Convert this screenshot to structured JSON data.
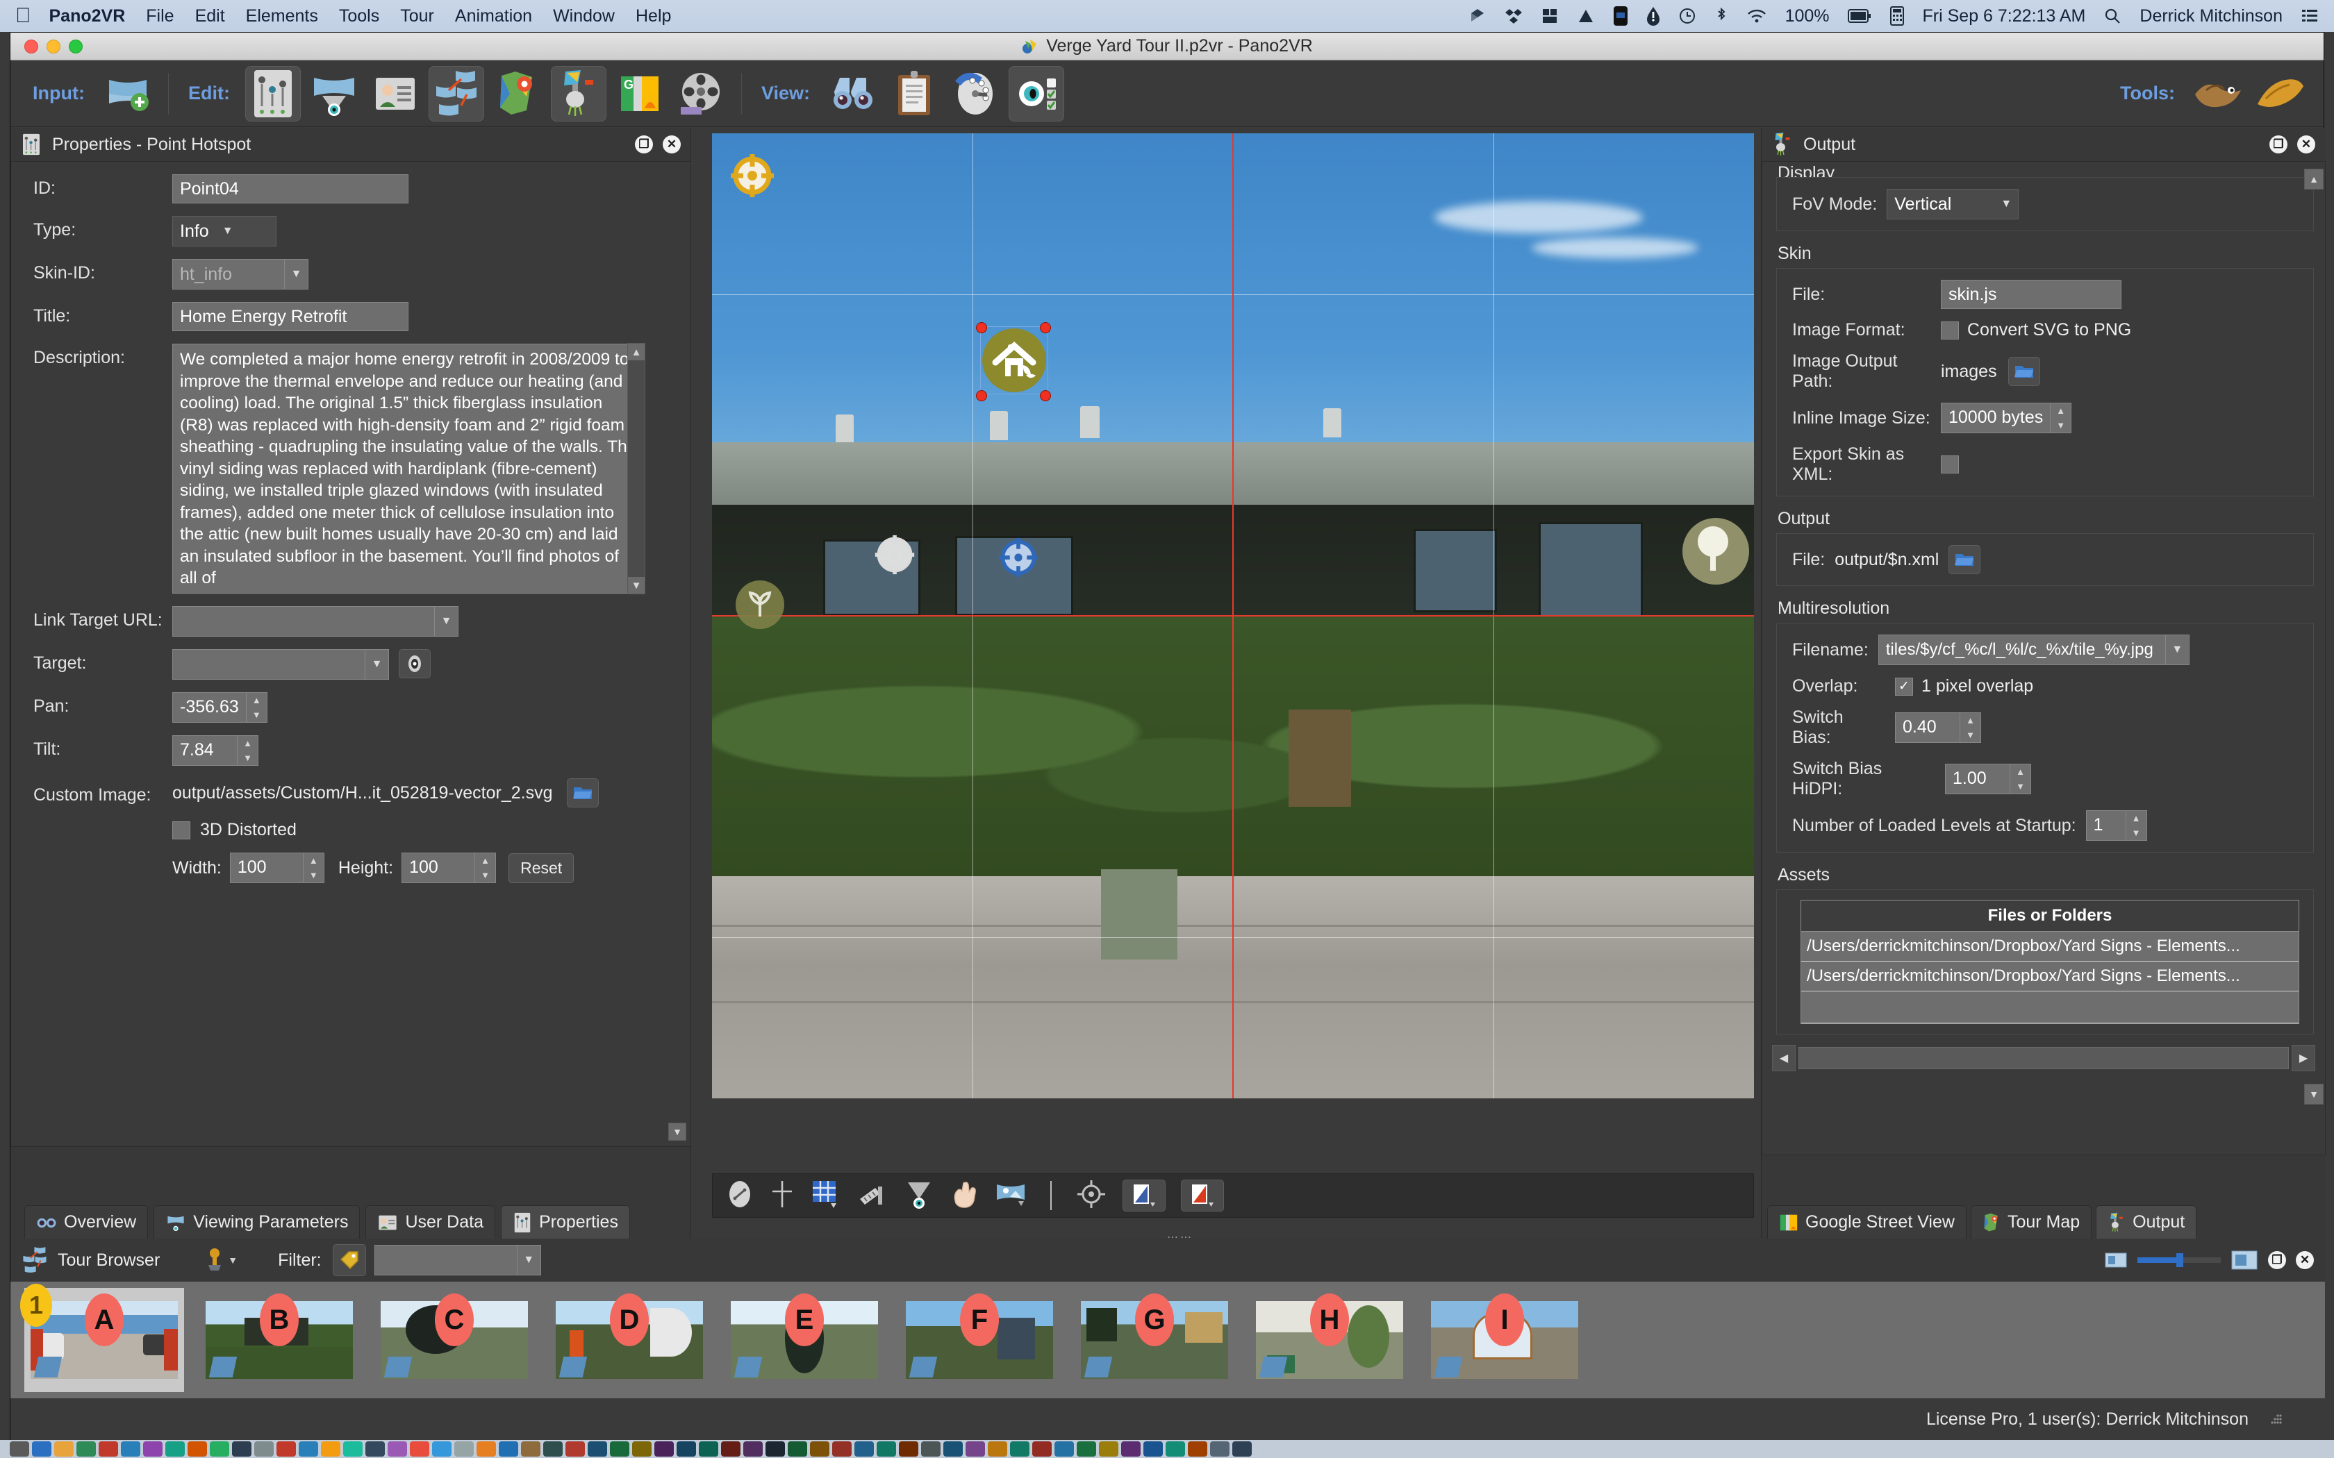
{
  "macbar": {
    "apple_icon": "apple-logo",
    "app_name": "Pano2VR",
    "menus": [
      "File",
      "Edit",
      "Elements",
      "Tools",
      "Tour",
      "Animation",
      "Window",
      "Help"
    ],
    "battery": "100%",
    "clock": "Fri Sep 6  7:22:13 AM",
    "user": "Derrick Mitchinson",
    "status_icons": [
      "dropbox-icon",
      "crashplan-icon",
      "grid-icon",
      "triangle-icon",
      "gopro-icon",
      "drop-icon",
      "timemachine-icon",
      "bluetooth-icon",
      "wifi-icon",
      "battery-icon",
      "calculator-icon",
      "search-icon",
      "menu-list-icon"
    ]
  },
  "window": {
    "title": "Verge Yard Tour II.p2vr - Pano2VR"
  },
  "toolbar": {
    "input_label": "Input:",
    "edit_label": "Edit:",
    "view_label": "View:",
    "tools_label": "Tools:",
    "input_buttons": [
      {
        "name": "add-panorama-icon"
      }
    ],
    "edit_buttons": [
      {
        "name": "properties-panel-icon",
        "selected": true
      },
      {
        "name": "viewing-parameters-icon",
        "selected": false
      },
      {
        "name": "user-data-icon",
        "selected": false
      },
      {
        "name": "tour-browser-icon",
        "selected": true
      },
      {
        "name": "tour-map-icon",
        "selected": false
      },
      {
        "name": "output-icon",
        "selected": true
      },
      {
        "name": "google-street-view-icon",
        "selected": false
      },
      {
        "name": "animation-icon",
        "selected": false
      }
    ],
    "view_buttons": [
      {
        "name": "overview-binoculars-icon",
        "selected": false
      },
      {
        "name": "clipboard-icon",
        "selected": false
      },
      {
        "name": "compass-icon",
        "selected": false
      },
      {
        "name": "visibility-eye-icon",
        "selected": true
      }
    ],
    "tools_buttons": [
      {
        "name": "patch-tool-icon"
      },
      {
        "name": "hand-tool-icon"
      }
    ]
  },
  "properties": {
    "panel_title": "Properties - Point Hotspot",
    "panel_icon": "properties-sliders-icon",
    "fields": {
      "id_label": "ID:",
      "id_value": "Point04",
      "type_label": "Type:",
      "type_value": "Info",
      "skin_id_label": "Skin-ID:",
      "skin_id_value": "ht_info",
      "title_label": "Title:",
      "title_value": "Home Energy Retrofit",
      "description_label": "Description:",
      "description_value": "We completed a major home energy retrofit in 2008/2009 to improve the thermal envelope and reduce our heating (and cooling) load. The original 1.5” thick fiberglass insulation (R8) was replaced with high-density foam and 2” rigid foam sheathing - quadrupling the insulating value of the walls. The vinyl siding was replaced with hardiplank (fibre-cement) siding, we installed triple glazed windows (with insulated frames), added one meter thick of cellulose insulation into the attic (new built homes usually have 20-30 cm) and laid an insulated subfloor in the basement. You’ll find photos of all of",
      "link_target_url_label": "Link Target URL:",
      "link_target_url_value": "",
      "target_label": "Target:",
      "target_value": "",
      "pan_label": "Pan:",
      "pan_value": "-356.63",
      "tilt_label": "Tilt:",
      "tilt_value": "7.84",
      "custom_image_label": "Custom Image:",
      "custom_image_value": "output/assets/Custom/H...it_052819-vector_2.svg",
      "distorted_label": "3D Distorted",
      "distorted_checked": false,
      "width_label": "Width:",
      "width_value": "100",
      "height_label": "Height:",
      "height_value": "100",
      "reset_label": "Reset"
    },
    "tabs": [
      {
        "label": "Overview",
        "icon": "binoculars-icon",
        "active": false
      },
      {
        "label": "Viewing Parameters",
        "icon": "viewing-parameters-icon",
        "active": false
      },
      {
        "label": "User Data",
        "icon": "user-data-icon",
        "active": false
      },
      {
        "label": "Properties",
        "icon": "properties-sliders-icon",
        "active": true
      }
    ]
  },
  "canvas": {
    "hotspots": [
      {
        "name": "hotspot-target-topleft",
        "kind": "target",
        "color": "#e8ab20"
      },
      {
        "name": "hotspot-home-energy",
        "kind": "image",
        "color": "#8c8a2c",
        "selected": true
      },
      {
        "name": "hotspot-target-center",
        "kind": "target",
        "color": "#e8e8e8"
      },
      {
        "name": "hotspot-plant-left",
        "kind": "image",
        "color": "#8b8a4e"
      },
      {
        "name": "hotspot-target-blue",
        "kind": "target",
        "color": "#3c78c8"
      },
      {
        "name": "hotspot-tree-right",
        "kind": "image",
        "color": "#9a9a72"
      }
    ],
    "toolbar_buttons": [
      {
        "name": "compass-icon"
      },
      {
        "name": "crosshair-icon"
      },
      {
        "name": "grid-icon"
      },
      {
        "name": "ruler-icon"
      },
      {
        "name": "visibility-cone-icon"
      },
      {
        "name": "hand-pan-icon"
      },
      {
        "name": "panorama-icon"
      },
      {
        "name": "center-target-icon"
      },
      {
        "name": "fill-color-swatch"
      },
      {
        "name": "stroke-color-swatch"
      }
    ],
    "fill_color": "#3a5ea8",
    "stroke_color": "#d83a1e"
  },
  "output": {
    "panel_title": "Output",
    "panel_icon": "output-icon",
    "groups": {
      "display_label": "Display",
      "fov_mode_label": "FoV Mode:",
      "fov_mode_value": "Vertical",
      "skin_label": "Skin",
      "skin_file_label": "File:",
      "skin_file_value": "skin.js",
      "image_format_label": "Image Format:",
      "convert_svg_label": "Convert SVG to PNG",
      "convert_svg_checked": false,
      "image_output_path_label": "Image Output Path:",
      "image_output_path_value": "images",
      "inline_image_size_label": "Inline Image Size:",
      "inline_image_size_value": "10000 bytes",
      "export_skin_xml_label": "Export Skin as XML:",
      "export_skin_xml_checked": false,
      "output_label": "Output",
      "output_file_label": "File:",
      "output_file_value": "output/$n.xml",
      "multires_label": "Multiresolution",
      "filename_label": "Filename:",
      "filename_value": "tiles/$y/cf_%c/l_%l/c_%x/tile_%y.jpg",
      "overlap_label": "Overlap:",
      "overlap_option": "1 pixel overlap",
      "overlap_checked": true,
      "switch_bias_label": "Switch Bias:",
      "switch_bias_value": "0.40",
      "switch_bias_hidpi_label": "Switch Bias HiDPI:",
      "switch_bias_hidpi_value": "1.00",
      "loaded_levels_label": "Number of Loaded Levels at Startup:",
      "loaded_levels_value": "1",
      "assets_label": "Assets",
      "assets_col_header": "Files or Folders",
      "assets_rows": [
        "/Users/derrickmitchinson/Dropbox/Yard Signs - Elements...",
        "/Users/derrickmitchinson/Dropbox/Yard Signs - Elements..."
      ]
    },
    "tabs": [
      {
        "label": "Google Street View",
        "icon": "google-street-view-icon",
        "active": false
      },
      {
        "label": "Tour Map",
        "icon": "tour-map-icon",
        "active": false
      },
      {
        "label": "Output",
        "icon": "output-icon",
        "active": true
      }
    ]
  },
  "tour_browser": {
    "title": "Tour Browser",
    "icon": "tour-browser-icon",
    "pin_icon": "pin-dropdown-icon",
    "filter_label": "Filter:",
    "filter_icon": "tag-icon",
    "filter_value": "",
    "zoom_small_icon": "thumb-small-icon",
    "zoom_large_icon": "thumb-large-icon",
    "nodes": [
      {
        "letter": "A",
        "number": "1",
        "selected": true
      },
      {
        "letter": "B",
        "number": "",
        "selected": false
      },
      {
        "letter": "C",
        "number": "",
        "selected": false
      },
      {
        "letter": "D",
        "number": "",
        "selected": false
      },
      {
        "letter": "E",
        "number": "",
        "selected": false
      },
      {
        "letter": "F",
        "number": "",
        "selected": false
      },
      {
        "letter": "G",
        "number": "",
        "selected": false
      },
      {
        "letter": "H",
        "number": "",
        "selected": false
      },
      {
        "letter": "I",
        "number": "",
        "selected": false
      }
    ]
  },
  "status": {
    "license_text": "License Pro, 1 user(s): Derrick Mitchinson"
  },
  "dock": {
    "colors": [
      "#5a5a5a",
      "#2b6fc0",
      "#e8a33d",
      "#2e8b57",
      "#c0392b",
      "#2980b9",
      "#8e44ad",
      "#16a085",
      "#d35400",
      "#27ae60",
      "#2c3e50",
      "#7f8c8d",
      "#c0392b",
      "#2980b9",
      "#f39c12",
      "#1abc9c",
      "#34495e",
      "#9b59b6",
      "#e74c3c",
      "#3498db",
      "#95a5a6",
      "#e67e22",
      "#1f6fb2",
      "#8e6b3d",
      "#2f4f4f",
      "#b03a2e",
      "#1b4f72",
      "#186a3b",
      "#7d6608",
      "#4a235a",
      "#154360",
      "#0e6251",
      "#641e16",
      "#512e5f",
      "#1b2631",
      "#145a32",
      "#7e5109",
      "#943126",
      "#21618c",
      "#117864",
      "#6e2c00",
      "#4d5656",
      "#1a5276",
      "#76448a",
      "#b9770e",
      "#117a65",
      "#922b21",
      "#2471a3",
      "#196f3d",
      "#9a7d0a",
      "#5b2c6f",
      "#1a5490",
      "#138d75",
      "#a04000",
      "#566573",
      "#2e4053"
    ]
  }
}
